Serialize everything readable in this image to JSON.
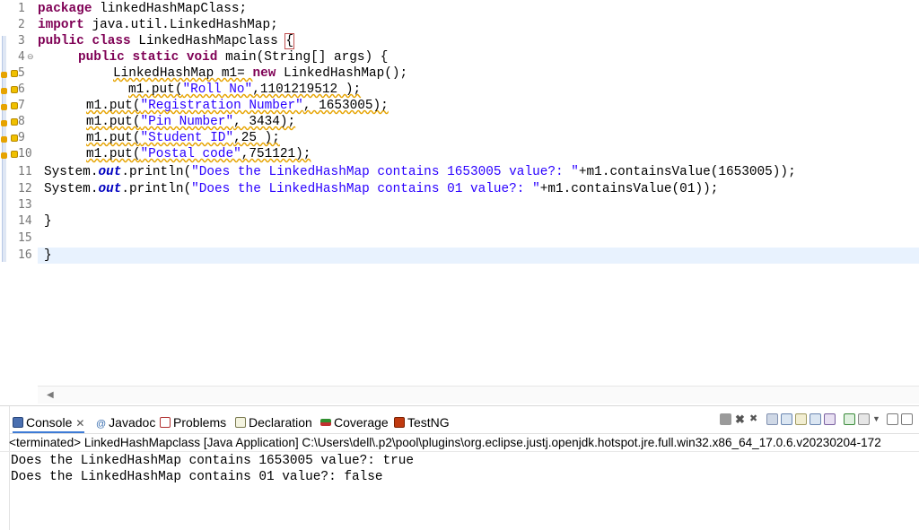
{
  "editor": {
    "line_numbers": [
      "1",
      "2",
      "3",
      "4",
      "5",
      "6",
      "7",
      "8",
      "9",
      "10",
      "11",
      "12",
      "13",
      "14",
      "15",
      "16"
    ],
    "lines": {
      "l1_kw": "package",
      "l1_rest": " linkedHashMapClass;",
      "l2_kw": "import",
      "l2_rest": " java.util.LinkedHashMap;",
      "l3_kw": "public class",
      "l3_rest": " LinkedHashMapclass ",
      "l3_brace": "{",
      "l4_kw": "public static void",
      "l4_rest": " main(String[] args) {",
      "l5_a": "LinkedHashMap m1= ",
      "l5_kw": "new",
      "l5_b": " LinkedHashMap();",
      "l6_a": "m1.put(",
      "l6_str": "\"Roll No\"",
      "l6_b": ",1101219512 );",
      "l7_a": "m1.put(",
      "l7_str": "\"Registration Number\"",
      "l7_b": ", 1653005);",
      "l8_a": "m1.put(",
      "l8_str": "\"Pin Number\"",
      "l8_b": ", 3434);",
      "l9_a": "m1.put(",
      "l9_str": "\"Student ID\"",
      "l9_b": ",25 );",
      "l10_a": "m1.put(",
      "l10_str": "\"Postal code\"",
      "l10_b": ",751121);",
      "l11_a": "System.",
      "l11_fld": "out",
      "l11_b": ".println(",
      "l11_str": "\"Does the LinkedHashMap contains 1653005 value?: \"",
      "l11_c": "+m1.containsValue(1653005));",
      "l12_a": "System.",
      "l12_fld": "out",
      "l12_b": ".println(",
      "l12_str": "\"Does the LinkedHashMap contains 01 value?: \"",
      "l12_c": "+m1.containsValue(01));",
      "l14": "}",
      "l16": "}"
    }
  },
  "panel": {
    "tabs": [
      {
        "label": "Console",
        "close": "✕"
      },
      {
        "label": "Javadoc"
      },
      {
        "label": "Problems"
      },
      {
        "label": "Declaration"
      },
      {
        "label": "Coverage"
      },
      {
        "label": "TestNG"
      }
    ],
    "status": "<terminated> LinkedHashMapclass [Java Application] C:\\Users\\dell\\.p2\\pool\\plugins\\org.eclipse.justj.openjdk.hotspot.jre.full.win32.x86_64_17.0.6.v20230204-172",
    "output": [
      "Does the LinkedHashMap contains 1653005 value?: true",
      "Does the LinkedHashMap contains 01 value?: false"
    ]
  },
  "colors": {
    "keyword": "#7f0055",
    "string": "#2a00ff",
    "field": "#0000c0",
    "current_line": "#e8f2fe",
    "warning": "#e6a300"
  },
  "icons": {
    "gutter_warning": "warning-icon",
    "fold": "fold-collapse-icon",
    "console": "console-icon",
    "javadoc": "javadoc-icon",
    "problems": "problems-icon",
    "declaration": "declaration-icon",
    "coverage": "coverage-icon",
    "testng": "testng-icon"
  }
}
